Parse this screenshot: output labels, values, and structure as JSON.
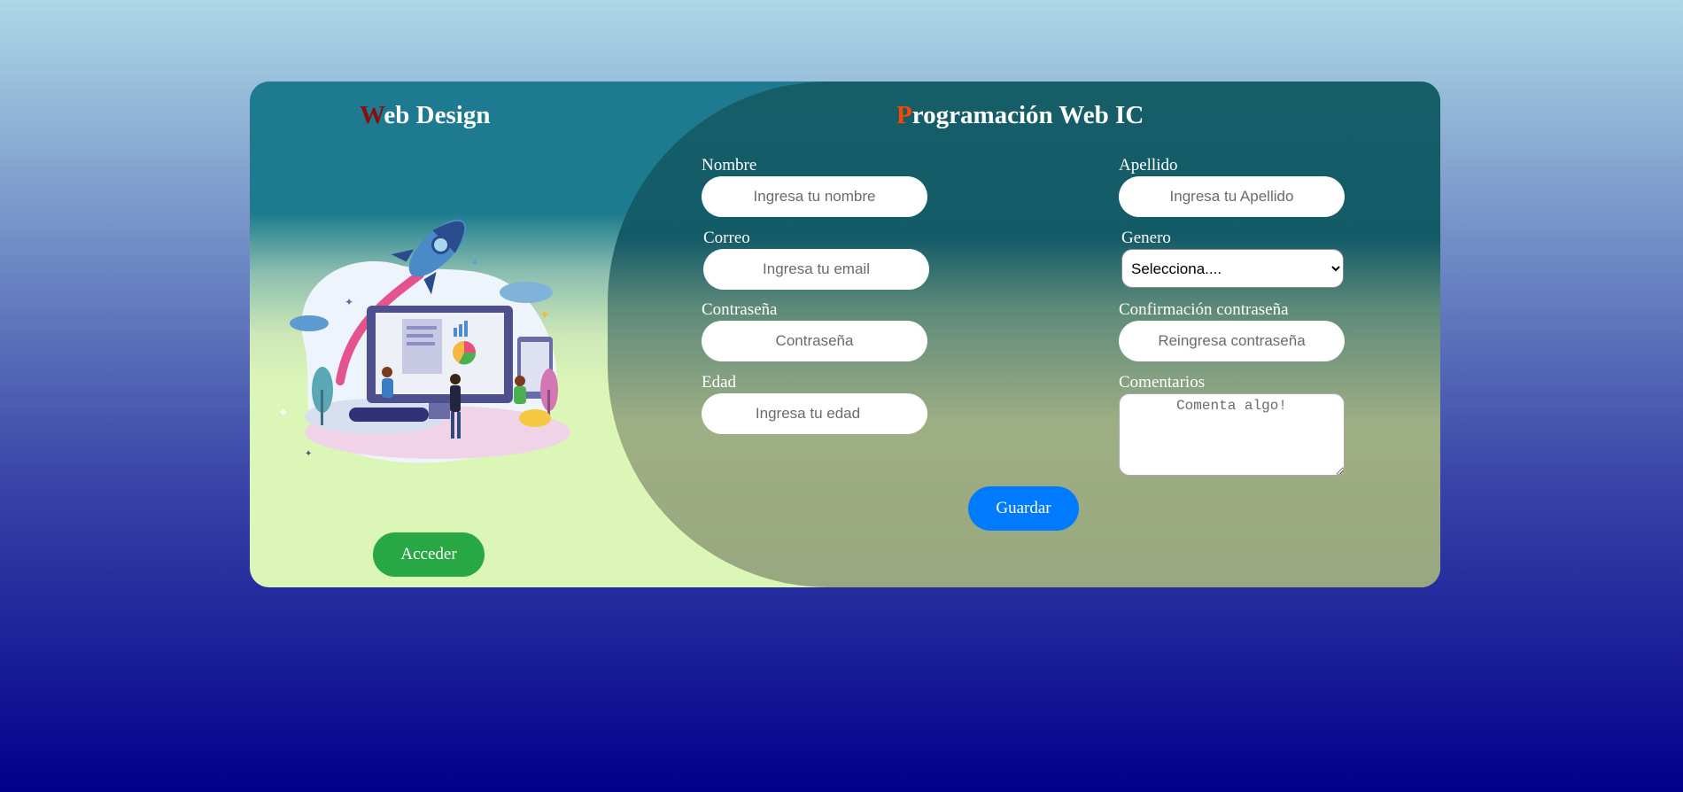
{
  "left": {
    "title_first": "W",
    "title_rest": "eb Design",
    "button": "Acceder"
  },
  "right": {
    "title_first": "P",
    "title_rest": "rogramación Web IC",
    "button": "Guardar"
  },
  "form": {
    "nombre": {
      "label": "Nombre",
      "placeholder": "Ingresa tu nombre"
    },
    "apellido": {
      "label": "Apellido",
      "placeholder": "Ingresa tu Apellido"
    },
    "correo": {
      "label": "Correo",
      "placeholder": "Ingresa tu email"
    },
    "genero": {
      "label": "Genero",
      "selected": "Selecciona...."
    },
    "contrasena": {
      "label": "Contraseña",
      "placeholder": "Contraseña"
    },
    "confirmacion": {
      "label": "Confirmación contraseña",
      "placeholder": "Reingresa contraseña"
    },
    "edad": {
      "label": "Edad",
      "placeholder": "Ingresa tu edad"
    },
    "comentarios": {
      "label": "Comentarios",
      "placeholder": "Comenta algo!"
    }
  },
  "colors": {
    "acceder": "#28a745",
    "guardar": "#007bff",
    "left_initial": "#8b0d0d",
    "right_initial": "#ff4500"
  }
}
